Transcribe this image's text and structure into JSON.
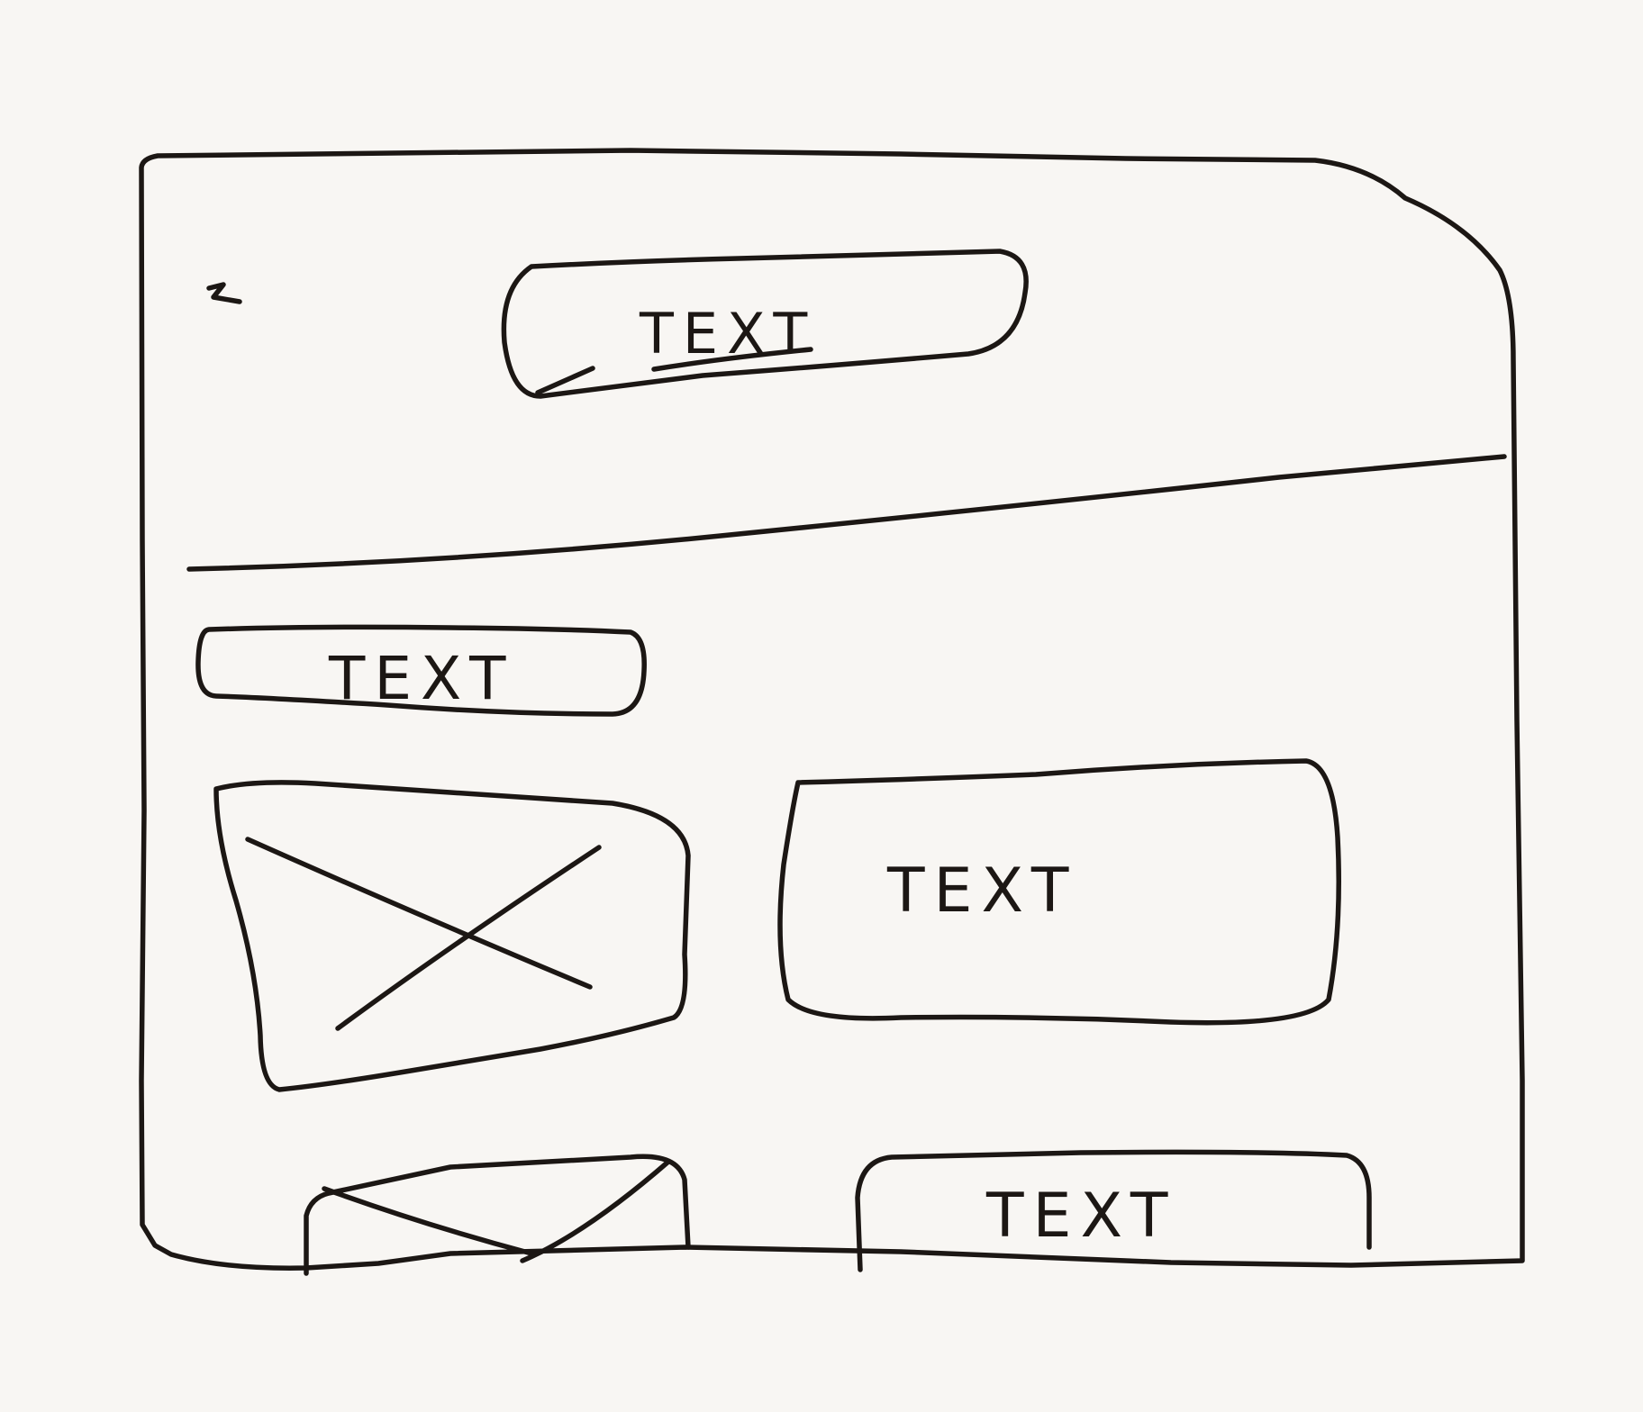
{
  "page": {
    "background_color": "#f8f6f3",
    "ink_color": "#1c1714"
  },
  "header": {
    "title_box_text": "TEXT"
  },
  "content": {
    "section_label_text": "TEXT",
    "row1": {
      "image_placeholder": "image-placeholder-icon",
      "text_card_text": "TEXT"
    },
    "row2": {
      "image_placeholder": "image-placeholder-icon",
      "text_card_text": "TEXT"
    }
  }
}
